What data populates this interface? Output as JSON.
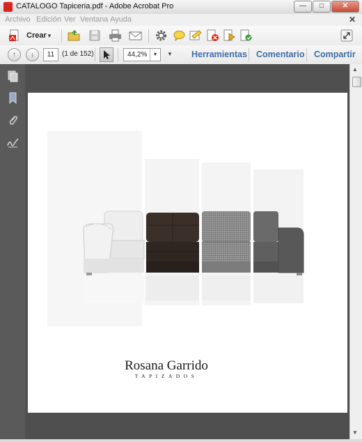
{
  "window": {
    "title": "CATALOGO Tapiceria.pdf - Adobe Acrobat Pro",
    "minimize": "—",
    "maximize": "□",
    "close": "✕"
  },
  "menu": {
    "items": [
      "Archivo",
      "Edición",
      "Ver",
      "Ventana",
      "Ayuda"
    ],
    "close_doc": "✕"
  },
  "toolbar": {
    "crear_label": "Crear",
    "icons": [
      "create-pdf-icon",
      "open-folder-icon",
      "save-icon",
      "print-icon",
      "email-icon",
      "settings-gear-icon",
      "comment-bubble-icon",
      "highlight-icon",
      "stamp-icon",
      "document-review-icon",
      "attach-icon"
    ]
  },
  "navigation": {
    "current_page": "11",
    "page_of": "(1 de 152)",
    "zoom": "44,2%"
  },
  "panes": {
    "herramientas": "Herramientas",
    "comentario": "Comentario",
    "compartir": "Compartir"
  },
  "document": {
    "brand_name": "Rosana Garrido",
    "brand_sub": "TAPIZADOS"
  },
  "colors": {
    "accent_blue": "#3d6ea8",
    "doc_background": "#4f4f4f",
    "panel_background": "#5a5a5a",
    "pdf_red": "#d8261c"
  }
}
